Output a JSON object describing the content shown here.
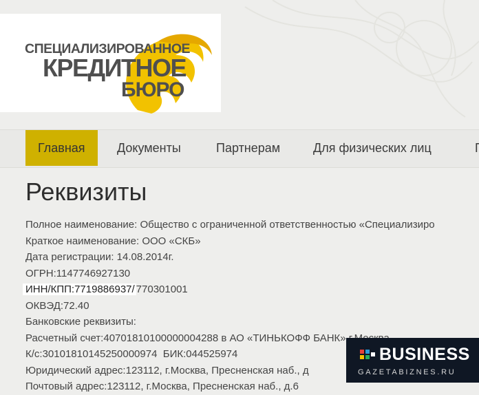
{
  "logo": {
    "line1": "СПЕЦИАЛИЗИРОВАННОЕ",
    "line2": "КРЕДИТНОЕ",
    "line3": "БЮРО"
  },
  "nav": {
    "items": [
      "Главная",
      "Документы",
      "Партнерам",
      "Для физических лиц",
      "П"
    ],
    "active_index": 0
  },
  "page_title": "Реквизиты",
  "details": [
    {
      "label": "Полное наименование:",
      "value": " Общество с ограниченной ответственностью «Специализиро"
    },
    {
      "label": "Краткое наименование:",
      "value": " ООО «СКБ»"
    },
    {
      "label": "Дата регистрации:",
      "value": " 14.08.2014г."
    },
    {
      "label": "ОГРН:",
      "value": "1147746927130"
    },
    {
      "label": "ИНН/КПП:",
      "value": "7719886937/770301001",
      "highlighted_part": "ИНН/КПП:7719886937/",
      "rest": "770301001"
    },
    {
      "label": "ОКВЭД:",
      "value": "72.40"
    },
    {
      "label": "Банковские реквизиты:",
      "value": ""
    },
    {
      "label": "Расчетный счет:",
      "value": "40701810100000004288 в АО «ТИНЬКОФФ БАНК» г.Москва"
    },
    {
      "label": "К/с:",
      "value": "30101810145250000974  БИК:044525974"
    },
    {
      "label": "Юридический адрес:",
      "value": "123112, г.Москва, Пресненская наб., д"
    },
    {
      "label": "Почтовый адрес:",
      "value": "123112, г.Москва, Пресненская наб., д.6"
    }
  ],
  "watermark": {
    "word": "BUSINESS",
    "site": "GAZETABIZNES.RU"
  },
  "colors": {
    "accent": "#cfb100",
    "logo_gold": "#f2c200",
    "background": "#eeeeec"
  }
}
